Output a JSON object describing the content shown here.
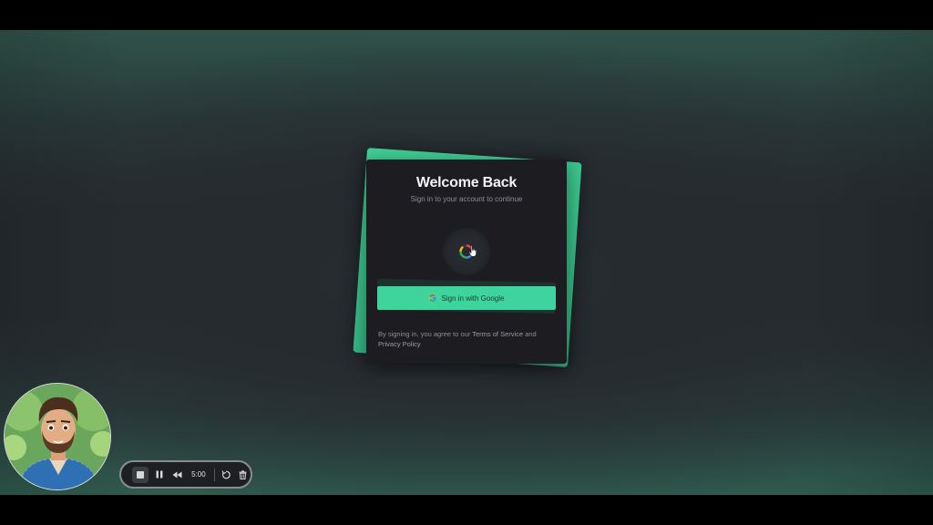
{
  "login": {
    "title": "Welcome Back",
    "subtitle": "Sign in to your account to continue",
    "google_button_label": "Sign in with Google",
    "terms_prefix": "By signing in, you agree to our ",
    "terms_link": "Terms of Service",
    "terms_and": " and",
    "privacy_link": "Privacy Policy"
  },
  "recorder": {
    "timer": "5:00",
    "icons": [
      "stop-icon",
      "pause-icon",
      "rewind-icon",
      "restart-icon",
      "trash-icon"
    ]
  },
  "colors": {
    "accent_green": "#3ed49a",
    "card_bg": "#1c1c21",
    "background": "#262c30"
  }
}
